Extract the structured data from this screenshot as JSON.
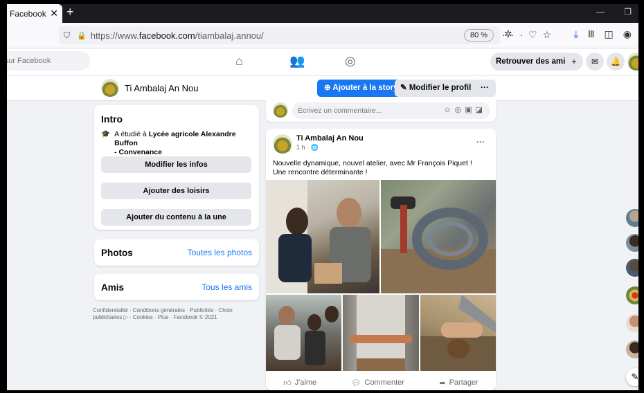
{
  "browser": {
    "tab_title": "Facebook",
    "url_prefix": "https://www.",
    "url_domain": "facebook.com",
    "url_path": "/tiambalaj.annou/",
    "zoom": "80 %"
  },
  "fbnav": {
    "search_placeholder": "r sur Facebook",
    "find_friends": "Retrouver des amis"
  },
  "profile": {
    "name": "Ti Ambalaj An Nou",
    "add_story": "Ajouter à la story",
    "edit_profile": "Modifier le profil",
    "more": "···"
  },
  "intro": {
    "title": "Intro",
    "studied_prefix": "A étudié à ",
    "studied_school": "Lycée agricole Alexandre Buffon",
    "studied_suffix": "- Convenance",
    "edit_info": "Modifier les infos",
    "add_hobbies": "Ajouter des loisirs",
    "add_featured": "Ajouter du contenu à la une"
  },
  "photos_card": {
    "title": "Photos",
    "link": "Toutes les photos"
  },
  "friends_card": {
    "title": "Amis",
    "link": "Tous les amis"
  },
  "footer": "Confidentialité · Conditions générales · Publicités · Choix publicitaires ▷ · Cookies · Plus · Facebook © 2021",
  "comment_bar": {
    "placeholder": "Écrivez un commentaire..."
  },
  "post": {
    "author": "Ti Ambalaj An Nou",
    "time": "1 h · 🌐",
    "more": "···",
    "text": "Nouvelle dynamique, nouvel atelier, avec Mr François Piquet !\nUne rencontre déterminante !",
    "like": "J'aime",
    "comment": "Commenter",
    "share": "Partager"
  }
}
